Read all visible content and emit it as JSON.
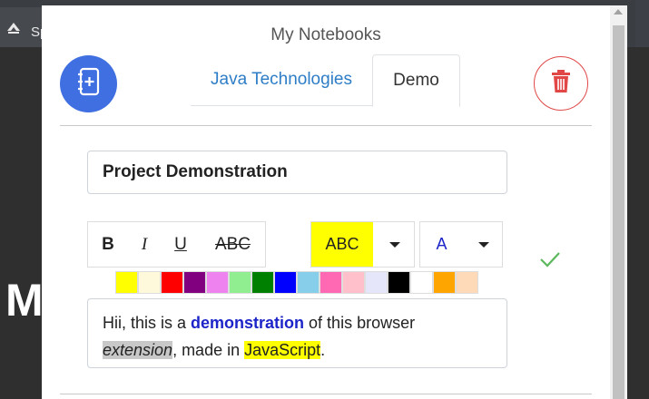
{
  "background": {
    "tab_label": "Sp",
    "big_text": "M"
  },
  "popup": {
    "title": "My Notebooks",
    "tabs": [
      {
        "label": "Java Technologies",
        "active": false
      },
      {
        "label": "Demo",
        "active": true
      }
    ],
    "note_title_value": "Project Demonstration",
    "format_buttons": {
      "bold": "B",
      "italic": "I",
      "underline": "U",
      "strike": "ABC"
    },
    "highlight_preview": "ABC",
    "font_color_preview": "A",
    "highlight_color": "#ffff00",
    "font_color": "#1d25c9",
    "swatches": [
      "#ffff00",
      "#fff9dc",
      "#ff0000",
      "#800080",
      "#ee82ee",
      "#90ee90",
      "#008000",
      "#0000ff",
      "#87ceeb",
      "#ff69b4",
      "#ffc0cb",
      "#e6e6fa",
      "#000000",
      "#ffffff",
      "#ffa500",
      "#ffdab9"
    ],
    "editor": {
      "t1": "Hii, this is a ",
      "t2": "demonstration",
      "t3": " of this browser ",
      "t4": "extension",
      "t5": ", made in ",
      "t6": "JavaScript",
      "t7": "."
    },
    "icons": {
      "add": "add-notebook-icon",
      "delete": "trash-icon",
      "confirm": "checkmark-icon"
    },
    "colors": {
      "accent": "#3f6fe0",
      "danger": "#e14747",
      "tab_link": "#2e7dc7",
      "check": "#5cb85c"
    }
  }
}
